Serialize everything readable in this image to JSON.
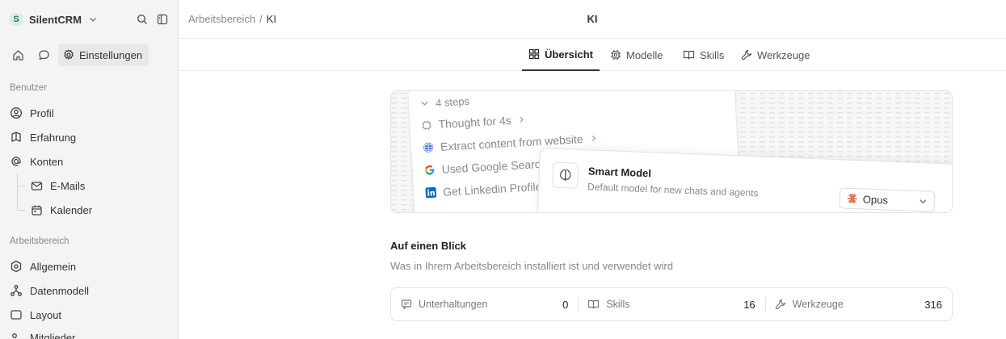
{
  "workspace": {
    "badge": "S",
    "name": "SilentCRM"
  },
  "nav": {
    "settings_label": "Einstellungen"
  },
  "sidebar": {
    "section_user": "Benutzer",
    "profile": "Profil",
    "experience": "Erfahrung",
    "accounts": "Konten",
    "emails": "E-Mails",
    "calendar": "Kalender",
    "section_workspace": "Arbeitsbereich",
    "general": "Allgemein",
    "data_model": "Datenmodell",
    "layout": "Layout",
    "members": "Mitglieder"
  },
  "header": {
    "breadcrumb_parent": "Arbeitsbereich",
    "breadcrumb_sep": "/",
    "breadcrumb_current": "KI",
    "title": "KI"
  },
  "tabs": {
    "overview": "Übersicht",
    "models": "Modelle",
    "skills": "Skills",
    "tools": "Werkzeuge"
  },
  "hero": {
    "steps": "4 steps",
    "thought": "Thought for 4s",
    "extract": "Extract content from website",
    "google": "Used Google Search",
    "linkedin": "Get Linkedin Profile",
    "model_title": "Smart Model",
    "model_desc": "Default model for new chats and agents",
    "model_value": "Opus"
  },
  "glance": {
    "title": "Auf einen Blick",
    "subtitle": "Was in Ihrem Arbeitsbereich installiert ist und verwendet wird"
  },
  "stats": [
    {
      "label": "Unterhaltungen",
      "value": "0",
      "icon": "chat-icon"
    },
    {
      "label": "Skills",
      "value": "16",
      "icon": "book-icon"
    },
    {
      "label": "Werkzeuge",
      "value": "316",
      "icon": "wrench-icon"
    }
  ],
  "colors": {
    "accent_badge_bg": "#d9f2e4",
    "accent_badge_fg": "#1e7a4a",
    "opus_spark": "#d9774b"
  }
}
